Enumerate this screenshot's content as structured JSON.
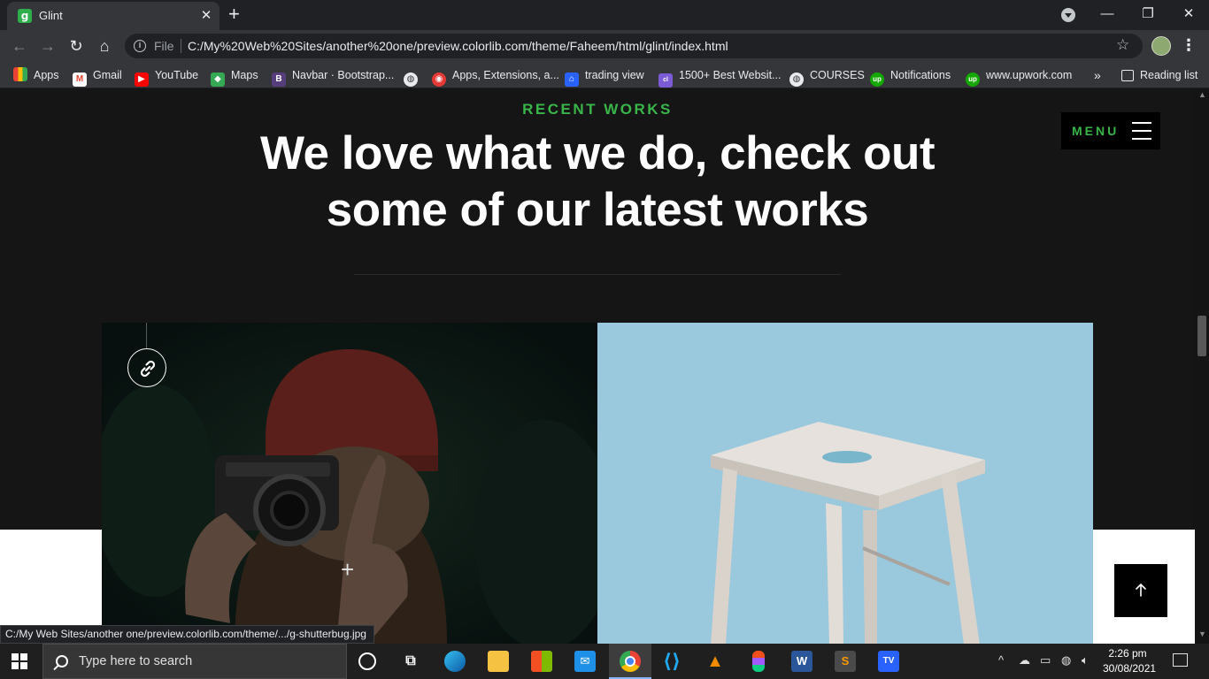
{
  "browser": {
    "tab_title": "Glint",
    "tab_favicon_letter": "g",
    "tab_close": "✕",
    "new_tab": "+",
    "file_label": "File",
    "url": "C:/My%20Web%20Sites/another%20one/preview.colorlib.com/theme/Faheem/html/glint/index.html",
    "window_controls": {
      "minimize": "—",
      "restore": "❐",
      "close": "✕"
    },
    "nav": {
      "back": "←",
      "forward": "→",
      "reload": "↻",
      "home": "⌂"
    },
    "bookmarks": [
      {
        "label": "Apps",
        "icon": "apps-grid-icon",
        "glyph": ""
      },
      {
        "label": "Gmail",
        "icon": "gmail-icon",
        "glyph": "M"
      },
      {
        "label": "YouTube",
        "icon": "youtube-icon",
        "glyph": "▶"
      },
      {
        "label": "Maps",
        "icon": "maps-icon",
        "glyph": "◆"
      },
      {
        "label": "Navbar · Bootstrap...",
        "icon": "bootstrap-icon",
        "glyph": "B"
      },
      {
        "label": "",
        "icon": "globe-icon",
        "glyph": "◍"
      },
      {
        "label": "Apps, Extensions, a...",
        "icon": "apps-extensions-icon",
        "glyph": "◉"
      },
      {
        "label": "trading view",
        "icon": "tradingview-icon",
        "glyph": "⌂"
      },
      {
        "label": "1500+ Best Websit...",
        "icon": "colorlib-icon",
        "glyph": "cl"
      },
      {
        "label": "COURSES",
        "icon": "globe-icon",
        "glyph": "◍"
      },
      {
        "label": "Notifications",
        "icon": "upwork-icon",
        "glyph": "up"
      },
      {
        "label": "www.upwork.com",
        "icon": "upwork-icon",
        "glyph": "up"
      }
    ],
    "bookmarks_overflow": "»",
    "reading_list": "Reading list",
    "status_url": "C:/My Web Sites/another one/preview.colorlib.com/theme/.../g-shutterbug.jpg"
  },
  "page": {
    "eyebrow": "RECENT WORKS",
    "headline_line1": "We love what we do, check out",
    "headline_line2": "some of our latest works",
    "menu_label": "MENU",
    "plus_mark": "+",
    "colors": {
      "accent": "#39b54a",
      "bg": "#151515",
      "stool_bg": "#9ac8dc"
    }
  },
  "taskbar": {
    "search_placeholder": "Type here to search",
    "time": "2:26 pm",
    "date": "30/08/2021",
    "up_arrow": "^"
  }
}
